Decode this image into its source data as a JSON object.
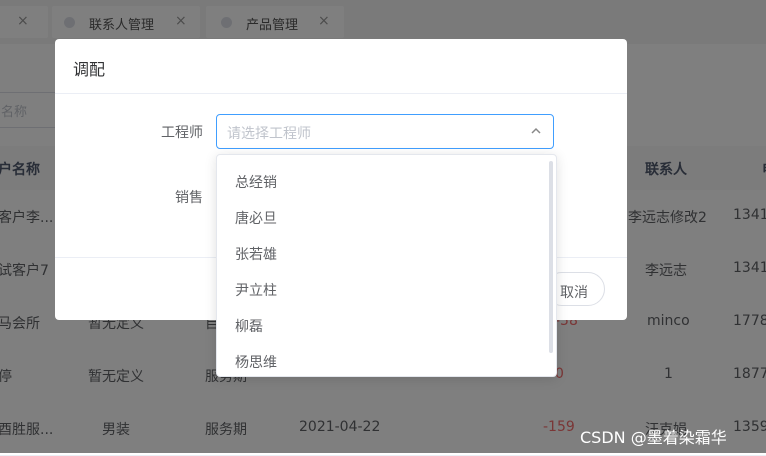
{
  "tabs": [
    {
      "label": "",
      "close": "×"
    },
    {
      "label": "联系人管理",
      "close": "×"
    },
    {
      "label": "产品管理",
      "close": "×"
    }
  ],
  "search": {
    "placeholder": "名称"
  },
  "table": {
    "headers": {
      "name": "户名称",
      "contact": "联系人",
      "phone": "电"
    },
    "rows": [
      {
        "name": "客户李...",
        "type": "",
        "status": "",
        "date": "",
        "days": "",
        "contact": "李远志修改2",
        "phone": "1341"
      },
      {
        "name": "试客户7",
        "type": "",
        "status": "",
        "date": "",
        "days": "",
        "contact": "李远志",
        "phone": "1341"
      },
      {
        "name": "马会所",
        "type": "暂无定义",
        "status": "自",
        "date": "",
        "days": "-58",
        "contact": "minco",
        "phone": "1778"
      },
      {
        "name": "停",
        "type": "暂无定义",
        "status": "服务期",
        "date": "",
        "days": "0",
        "contact": "1",
        "phone": "1877"
      },
      {
        "name": "酉胜服...",
        "type": "男装",
        "status": "服务期",
        "date": "2021-04-22",
        "days": "-159",
        "contact": "汪克娟",
        "phone": "1359"
      }
    ]
  },
  "dialog": {
    "title": "调配",
    "engineer_label": "工程师",
    "engineer_placeholder": "请选择工程师",
    "sales_label": "销售",
    "cancel_label": "取消"
  },
  "dropdown": {
    "options": [
      "总经销",
      "唐必旦",
      "张若雄",
      "尹立柱",
      "柳磊",
      "杨思维"
    ]
  },
  "watermark": "CSDN @墨着染霜华",
  "colors": {
    "primary": "#409eff",
    "negative": "#f56c6c",
    "mask": "rgba(0,0,0,0.5)"
  }
}
